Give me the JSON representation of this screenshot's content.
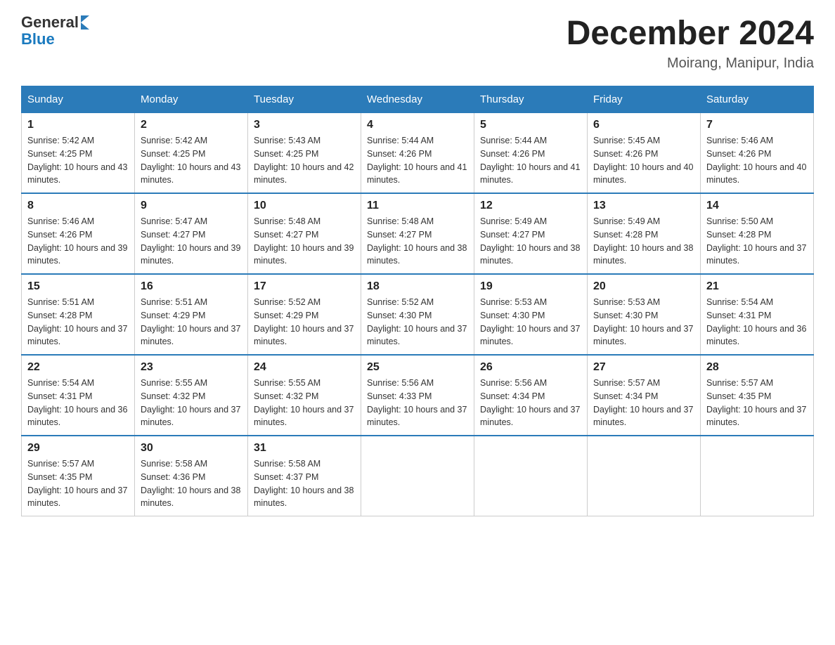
{
  "header": {
    "logo_general": "General",
    "logo_blue": "Blue",
    "title": "December 2024",
    "subtitle": "Moirang, Manipur, India"
  },
  "days_of_week": [
    "Sunday",
    "Monday",
    "Tuesday",
    "Wednesday",
    "Thursday",
    "Friday",
    "Saturday"
  ],
  "weeks": [
    [
      {
        "day": "1",
        "sunrise": "5:42 AM",
        "sunset": "4:25 PM",
        "daylight": "10 hours and 43 minutes."
      },
      {
        "day": "2",
        "sunrise": "5:42 AM",
        "sunset": "4:25 PM",
        "daylight": "10 hours and 43 minutes."
      },
      {
        "day": "3",
        "sunrise": "5:43 AM",
        "sunset": "4:25 PM",
        "daylight": "10 hours and 42 minutes."
      },
      {
        "day": "4",
        "sunrise": "5:44 AM",
        "sunset": "4:26 PM",
        "daylight": "10 hours and 41 minutes."
      },
      {
        "day": "5",
        "sunrise": "5:44 AM",
        "sunset": "4:26 PM",
        "daylight": "10 hours and 41 minutes."
      },
      {
        "day": "6",
        "sunrise": "5:45 AM",
        "sunset": "4:26 PM",
        "daylight": "10 hours and 40 minutes."
      },
      {
        "day": "7",
        "sunrise": "5:46 AM",
        "sunset": "4:26 PM",
        "daylight": "10 hours and 40 minutes."
      }
    ],
    [
      {
        "day": "8",
        "sunrise": "5:46 AM",
        "sunset": "4:26 PM",
        "daylight": "10 hours and 39 minutes."
      },
      {
        "day": "9",
        "sunrise": "5:47 AM",
        "sunset": "4:27 PM",
        "daylight": "10 hours and 39 minutes."
      },
      {
        "day": "10",
        "sunrise": "5:48 AM",
        "sunset": "4:27 PM",
        "daylight": "10 hours and 39 minutes."
      },
      {
        "day": "11",
        "sunrise": "5:48 AM",
        "sunset": "4:27 PM",
        "daylight": "10 hours and 38 minutes."
      },
      {
        "day": "12",
        "sunrise": "5:49 AM",
        "sunset": "4:27 PM",
        "daylight": "10 hours and 38 minutes."
      },
      {
        "day": "13",
        "sunrise": "5:49 AM",
        "sunset": "4:28 PM",
        "daylight": "10 hours and 38 minutes."
      },
      {
        "day": "14",
        "sunrise": "5:50 AM",
        "sunset": "4:28 PM",
        "daylight": "10 hours and 37 minutes."
      }
    ],
    [
      {
        "day": "15",
        "sunrise": "5:51 AM",
        "sunset": "4:28 PM",
        "daylight": "10 hours and 37 minutes."
      },
      {
        "day": "16",
        "sunrise": "5:51 AM",
        "sunset": "4:29 PM",
        "daylight": "10 hours and 37 minutes."
      },
      {
        "day": "17",
        "sunrise": "5:52 AM",
        "sunset": "4:29 PM",
        "daylight": "10 hours and 37 minutes."
      },
      {
        "day": "18",
        "sunrise": "5:52 AM",
        "sunset": "4:30 PM",
        "daylight": "10 hours and 37 minutes."
      },
      {
        "day": "19",
        "sunrise": "5:53 AM",
        "sunset": "4:30 PM",
        "daylight": "10 hours and 37 minutes."
      },
      {
        "day": "20",
        "sunrise": "5:53 AM",
        "sunset": "4:30 PM",
        "daylight": "10 hours and 37 minutes."
      },
      {
        "day": "21",
        "sunrise": "5:54 AM",
        "sunset": "4:31 PM",
        "daylight": "10 hours and 36 minutes."
      }
    ],
    [
      {
        "day": "22",
        "sunrise": "5:54 AM",
        "sunset": "4:31 PM",
        "daylight": "10 hours and 36 minutes."
      },
      {
        "day": "23",
        "sunrise": "5:55 AM",
        "sunset": "4:32 PM",
        "daylight": "10 hours and 37 minutes."
      },
      {
        "day": "24",
        "sunrise": "5:55 AM",
        "sunset": "4:32 PM",
        "daylight": "10 hours and 37 minutes."
      },
      {
        "day": "25",
        "sunrise": "5:56 AM",
        "sunset": "4:33 PM",
        "daylight": "10 hours and 37 minutes."
      },
      {
        "day": "26",
        "sunrise": "5:56 AM",
        "sunset": "4:34 PM",
        "daylight": "10 hours and 37 minutes."
      },
      {
        "day": "27",
        "sunrise": "5:57 AM",
        "sunset": "4:34 PM",
        "daylight": "10 hours and 37 minutes."
      },
      {
        "day": "28",
        "sunrise": "5:57 AM",
        "sunset": "4:35 PM",
        "daylight": "10 hours and 37 minutes."
      }
    ],
    [
      {
        "day": "29",
        "sunrise": "5:57 AM",
        "sunset": "4:35 PM",
        "daylight": "10 hours and 37 minutes."
      },
      {
        "day": "30",
        "sunrise": "5:58 AM",
        "sunset": "4:36 PM",
        "daylight": "10 hours and 38 minutes."
      },
      {
        "day": "31",
        "sunrise": "5:58 AM",
        "sunset": "4:37 PM",
        "daylight": "10 hours and 38 minutes."
      },
      null,
      null,
      null,
      null
    ]
  ]
}
